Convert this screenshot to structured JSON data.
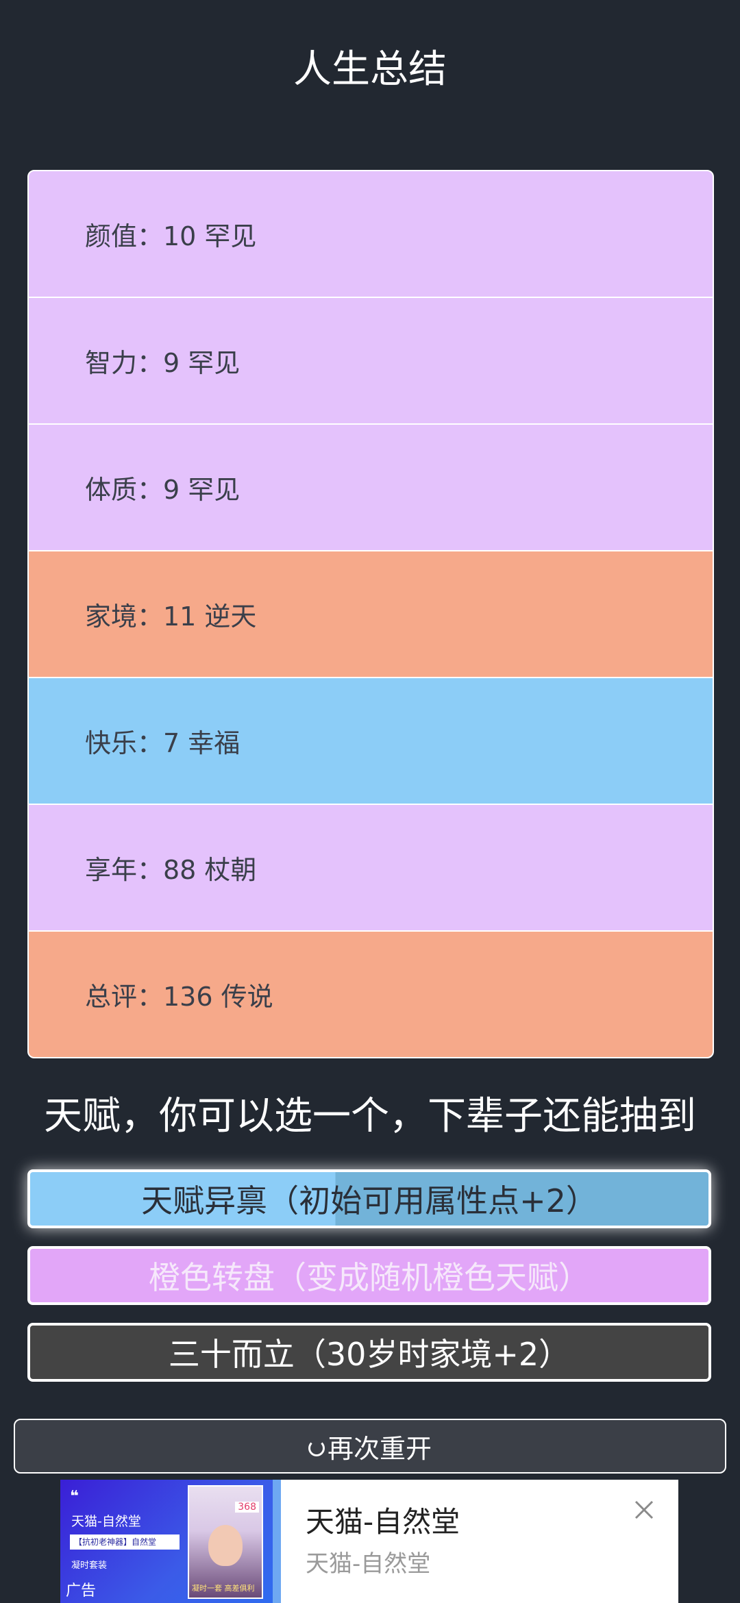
{
  "page_title": "人生总结",
  "stats": [
    {
      "label": "颜值：10 罕见",
      "color": "#e4c2fc"
    },
    {
      "label": "智力：9 罕见",
      "color": "#e4c2fc"
    },
    {
      "label": "体质：9 罕见",
      "color": "#e4c2fc"
    },
    {
      "label": "家境：11 逆天",
      "color": "#f6a98a"
    },
    {
      "label": "快乐：7 幸福",
      "color": "#8ccdf7"
    },
    {
      "label": "享年：88 杖朝",
      "color": "#e4c2fc"
    },
    {
      "label": "总评：136 传说",
      "color": "#f6a98a"
    }
  ],
  "talent_heading": "天赋，你可以选一个，下辈子还能抽到",
  "talents": [
    {
      "label": "天赋异禀（初始可用属性点+2）"
    },
    {
      "label": "橙色转盘（变成随机橙色天赋）"
    },
    {
      "label": "三十而立（30岁时家境+2）"
    }
  ],
  "restart_label": "再次重开",
  "ad": {
    "title": "天猫-自然堂",
    "subtitle": "天猫-自然堂",
    "image_quote": "❝",
    "image_title": "天猫-自然堂",
    "image_box_text": "【抗初老神器】自然堂",
    "image_line2": "凝时套装",
    "image_label": "广告",
    "photo_badge": "368",
    "photo_caption": "凝时一套 高差俱利"
  }
}
